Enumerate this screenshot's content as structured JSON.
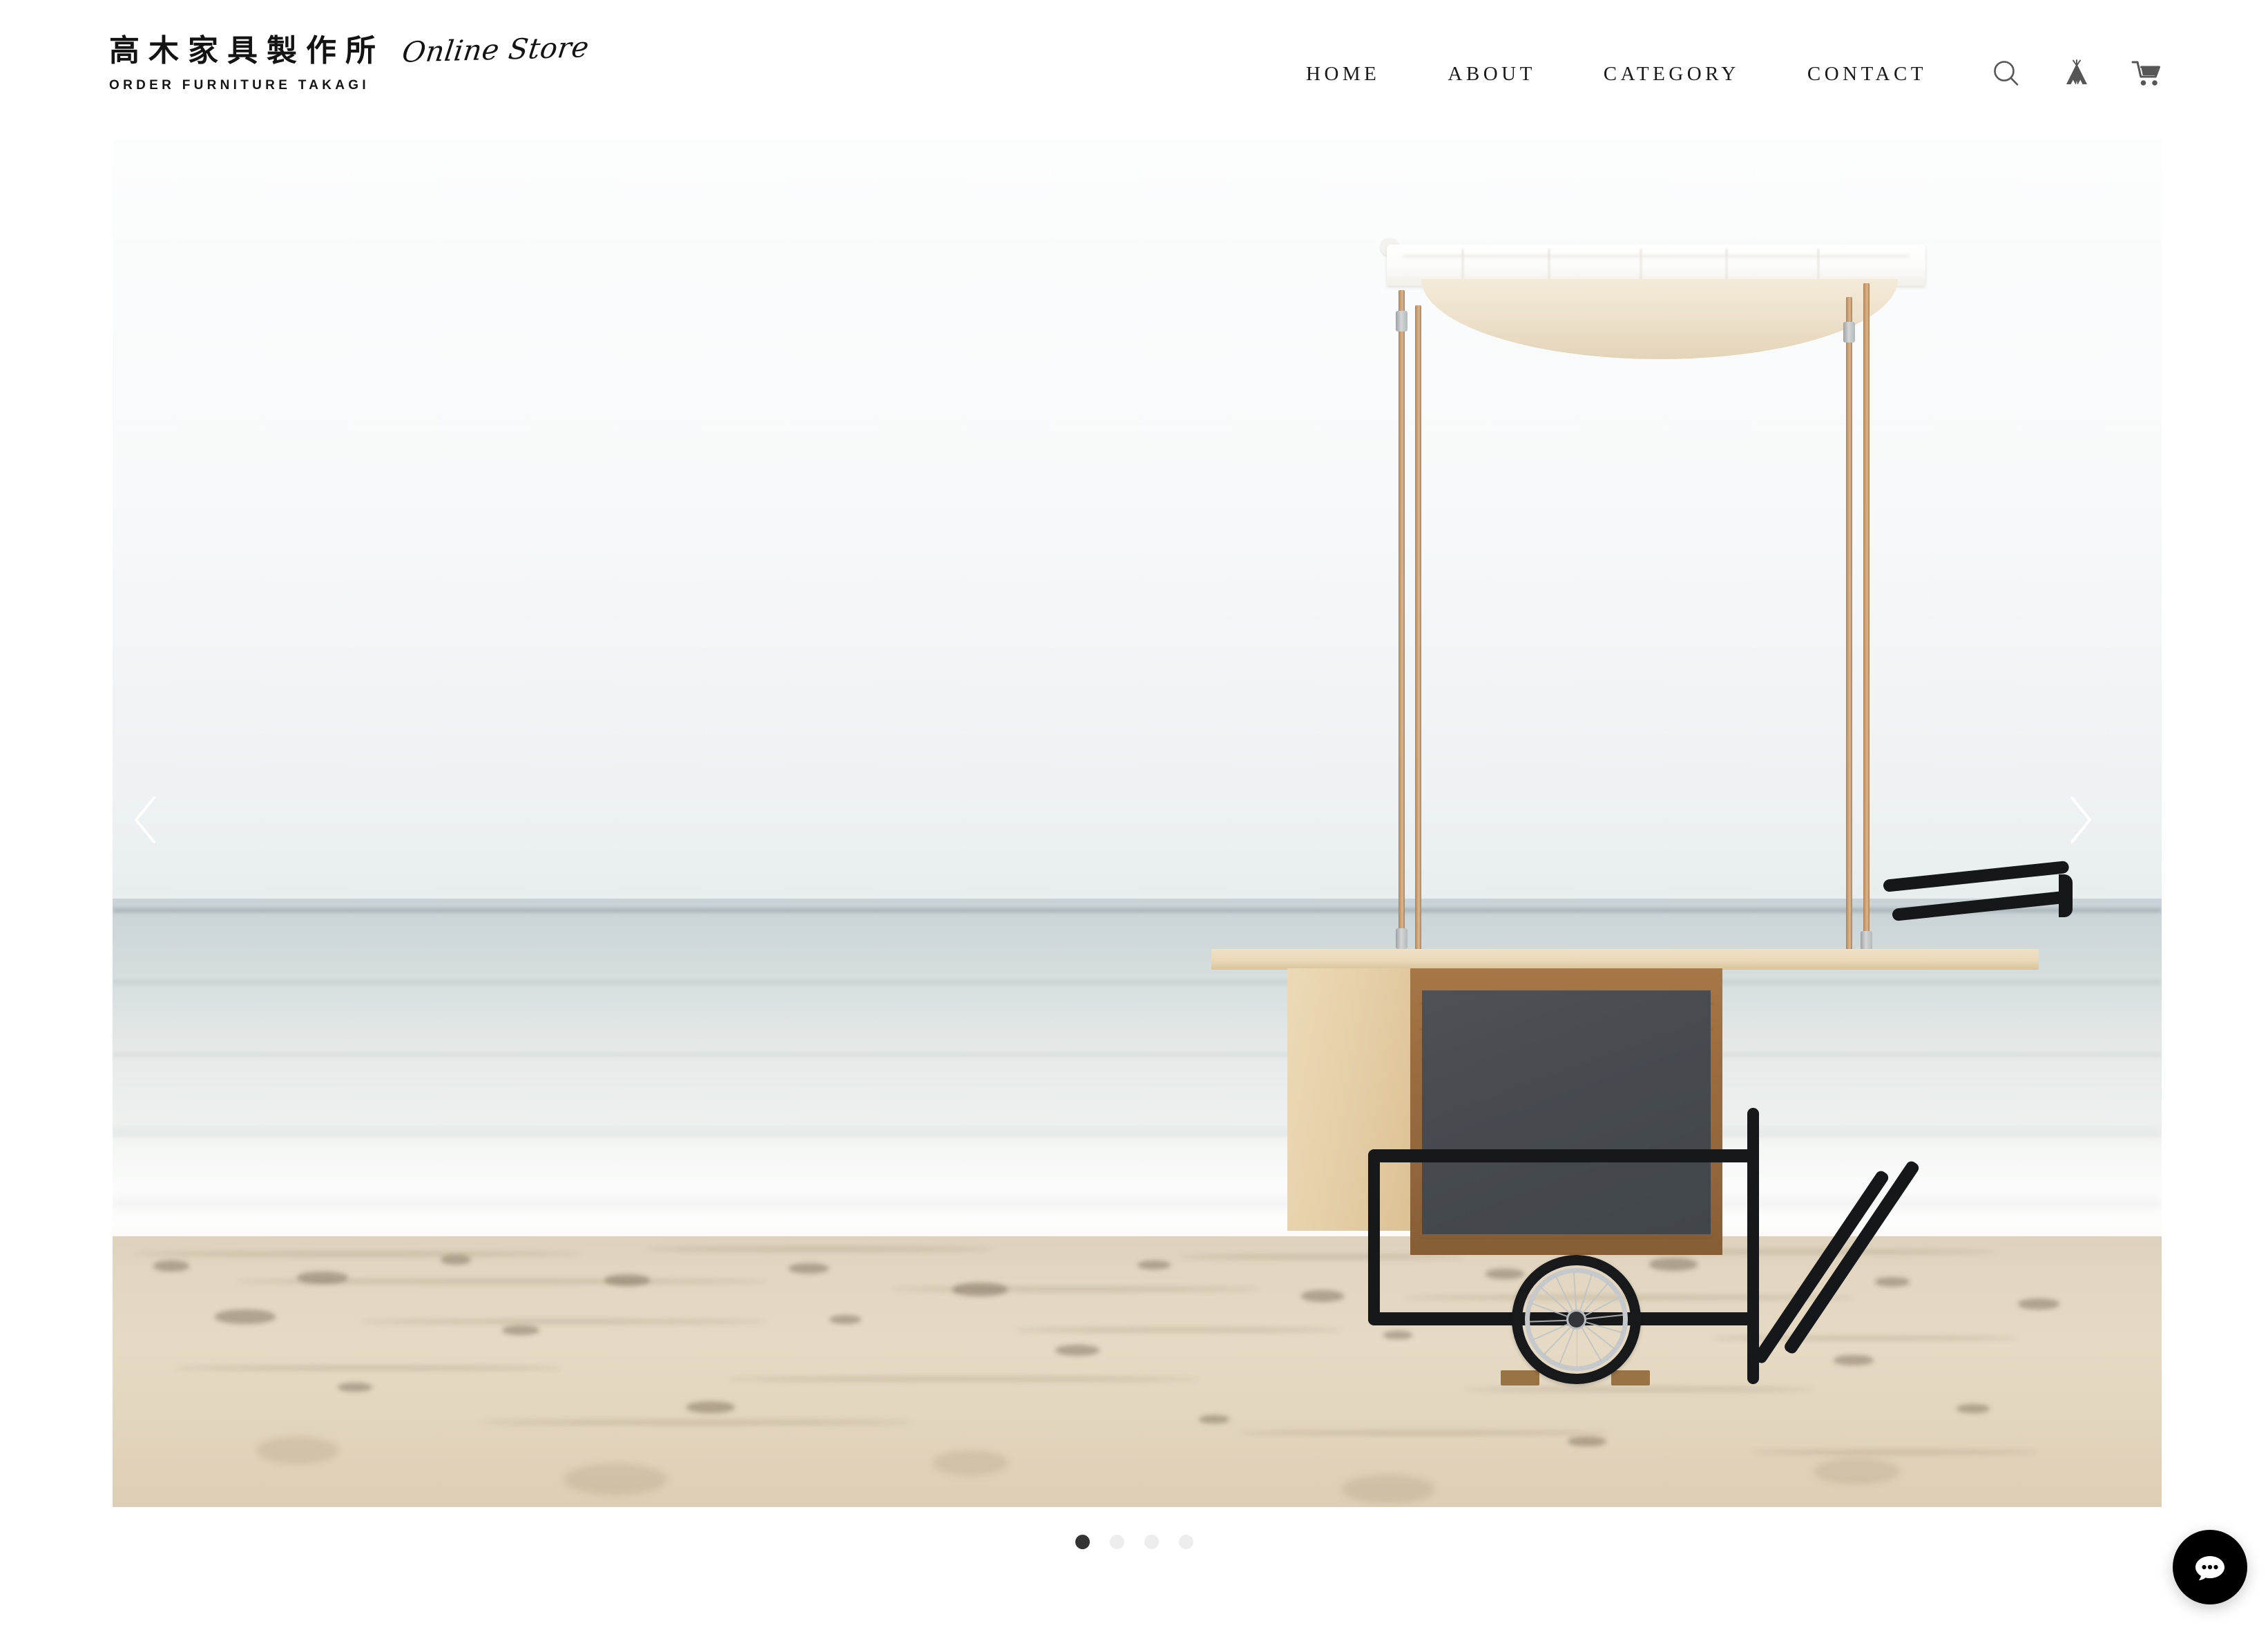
{
  "header": {
    "brand": {
      "name_jp": "高木家具製作所",
      "script": "Online Store",
      "tagline": "ORDER FURNITURE TAKAGI"
    },
    "nav": [
      {
        "label": "HOME",
        "name": "nav-link-home"
      },
      {
        "label": "ABOUT",
        "name": "nav-link-about"
      },
      {
        "label": "CATEGORY",
        "name": "nav-link-category"
      },
      {
        "label": "CONTACT",
        "name": "nav-link-contact"
      }
    ],
    "icons": [
      {
        "name": "search-icon",
        "title": "Search"
      },
      {
        "name": "teepee-icon",
        "title": "Tent"
      },
      {
        "name": "cart-icon",
        "title": "Cart"
      }
    ]
  },
  "hero": {
    "alt": "Wooden mobile vending cart with white canvas canopy standing on a sandy beach by the sea",
    "prev_label": "‹",
    "next_label": "›",
    "slide_count": 4,
    "active_slide": 1
  },
  "chat": {
    "label": "chat-bubble",
    "dots": "•••"
  },
  "colors": {
    "text": "#1a1a1a",
    "icon": "#555555",
    "dot_active": "#333333",
    "dot_inactive": "#ededed",
    "chat_bg": "#000000",
    "sand": "#e2d6c0",
    "sea": "#d3dbdd",
    "sky": "#f8fafb",
    "wood_light": "#e8d3b0",
    "wood_frame": "#9a6f47",
    "chalkboard": "#474b50",
    "steel": "#16181a"
  }
}
